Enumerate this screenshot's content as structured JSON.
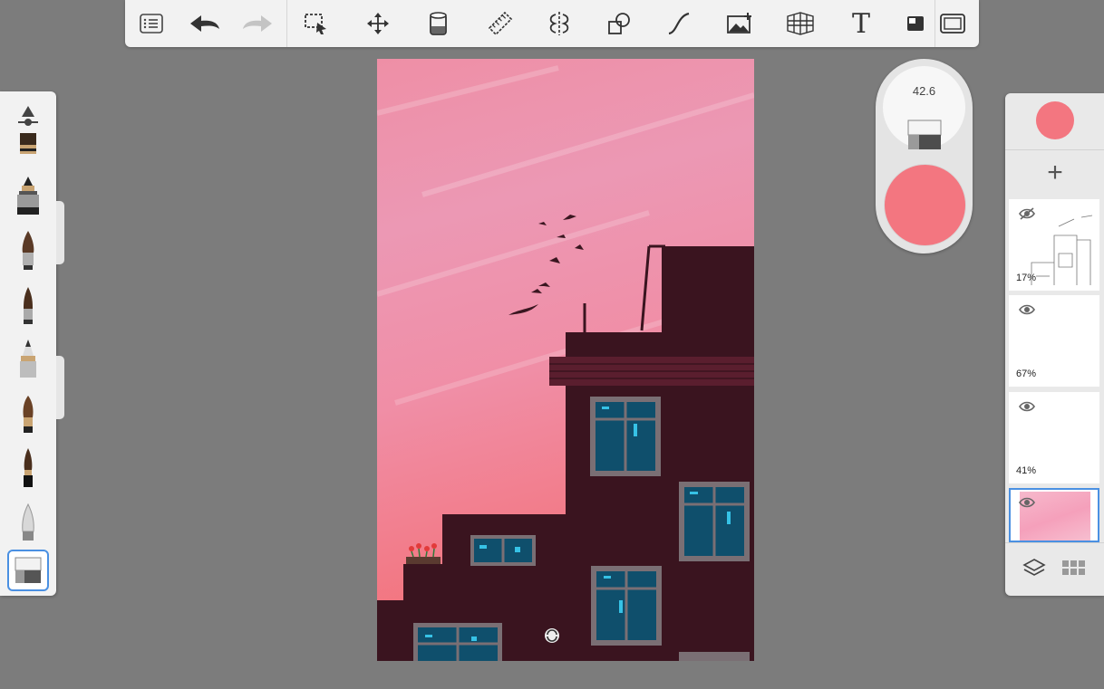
{
  "toolbar": {
    "buttons": [
      "menu-icon",
      "undo-icon",
      "redo-icon",
      "selection-icon",
      "transform-icon",
      "fill-icon",
      "ruler-icon",
      "symmetry-icon",
      "shape-icon",
      "curve-icon",
      "image-icon",
      "perspective-icon",
      "text-icon",
      "flipbook-icon",
      "fullscreen-icon"
    ],
    "text_glyph": "T"
  },
  "brushes": [
    "brush-settings-icon",
    "blender-brush",
    "ink-pen-brush",
    "paint-brush",
    "pointed-brush",
    "pencil-brush",
    "watercolor-brush",
    "fineliner-brush",
    "airbrush",
    "eraser-brush"
  ],
  "puck": {
    "size_value": "42.6",
    "color": "#f37680"
  },
  "layers_panel": {
    "current_color": "#f37680",
    "add_label": "+",
    "layers": [
      {
        "opacity": "17%",
        "visible": false
      },
      {
        "opacity": "67%",
        "visible": true
      },
      {
        "opacity": "41%",
        "visible": true
      },
      {
        "opacity": "",
        "visible": true,
        "selected": true
      }
    ]
  }
}
